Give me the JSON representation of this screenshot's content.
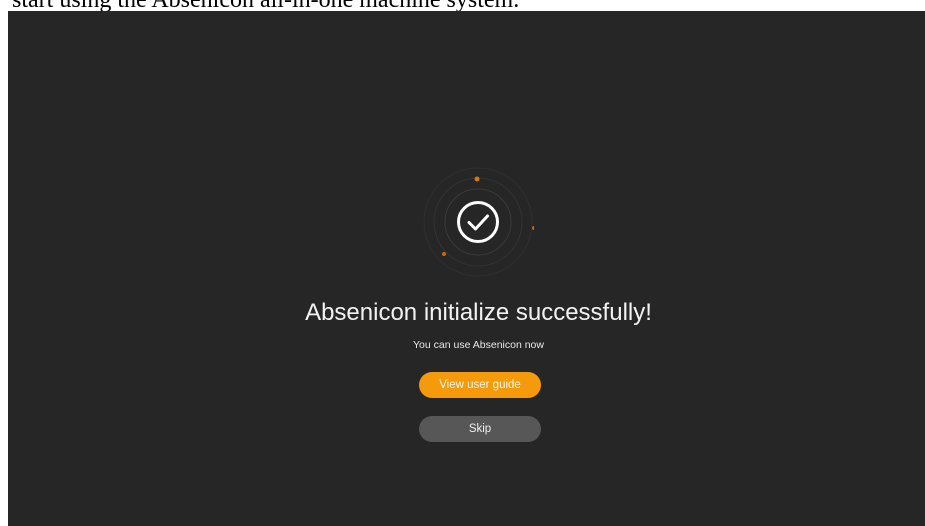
{
  "caption": "start using the Absenicon all-in-one machine system.",
  "screen": {
    "success_icon": "check-circle-icon",
    "title": "Absenicon initialize successfully!",
    "subtitle": "You can use Absenicon now",
    "primary_button_label": "View user guide",
    "secondary_button_label": "Skip"
  },
  "colors": {
    "background": "#262626",
    "accent": "#f59a0b",
    "secondary_button": "#575757",
    "text": "#f2f2f2"
  }
}
